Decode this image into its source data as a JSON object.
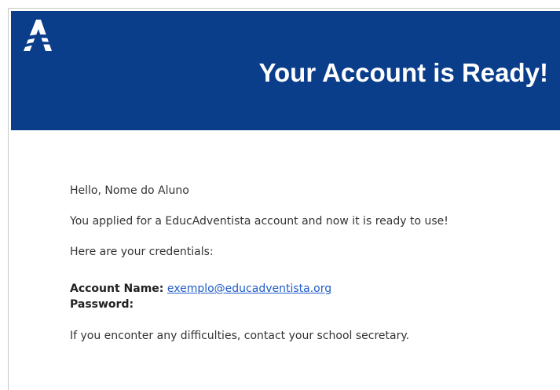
{
  "header": {
    "logo_icon": "educadventista-logo-icon",
    "title": "Your Account is Ready!",
    "background_color": "#0a3d8a"
  },
  "body": {
    "greeting": "Hello, Nome do Aluno",
    "applied_text": "You applied for a EducAdventista account and now it is ready to use!",
    "credentials_intro": "Here are your credentials:",
    "account_name_label": "Account Name:",
    "account_name_value": "exemplo@educadventista.org",
    "password_label": "Password:",
    "difficulties_text": "If you enconter any difficulties, contact your school secretary."
  },
  "colors": {
    "link": "#1f5cc9"
  }
}
